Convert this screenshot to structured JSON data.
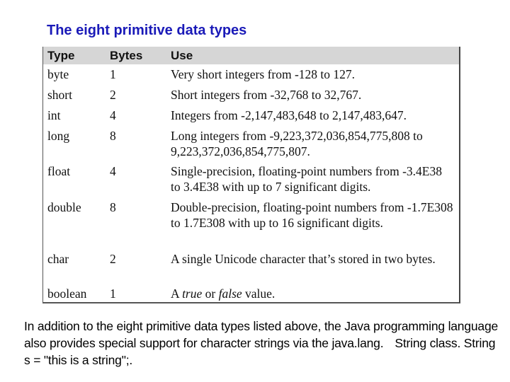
{
  "title": "The eight primitive data types",
  "colors": {
    "title": "#1a1ab8",
    "header_bg": "#d6d6d6"
  },
  "table": {
    "headers": {
      "type": "Type",
      "bytes": "Bytes",
      "use": "Use"
    },
    "rows": [
      {
        "type": "byte",
        "bytes": "1",
        "use": "Very short integers from -128 to 127."
      },
      {
        "type": "short",
        "bytes": "2",
        "use": "Short integers from -32,768 to 32,767."
      },
      {
        "type": "int",
        "bytes": "4",
        "use": "Integers from -2,147,483,648 to 2,147,483,647."
      },
      {
        "type": "long",
        "bytes": "8",
        "use": "Long integers from -9,223,372,036,854,775,808 to 9,223,372,036,854,775,807."
      },
      {
        "type": "float",
        "bytes": "4",
        "use": "Single-precision, floating-point numbers from -3.4E38 to 3.4E38 with up to 7 significant digits."
      },
      {
        "type": "double",
        "bytes": "8",
        "use": "Double-precision, floating-point numbers from -1.7E308 to 1.7E308 with up to 16 significant digits."
      },
      {
        "type": "char",
        "bytes": "2",
        "use": "A single Unicode character that’s stored in two bytes."
      },
      {
        "type": "boolean",
        "bytes": "1",
        "use_parts": {
          "a": "A ",
          "true": "true",
          "or": " or ",
          "false": "false",
          "end": " value."
        }
      }
    ]
  },
  "paragraph": {
    "part1": "In addition to the eight primitive data types listed above, the Java programming language also provides special support for character strings via the java.lang.",
    "part2": "String class. String s = \"this is a string\";."
  }
}
